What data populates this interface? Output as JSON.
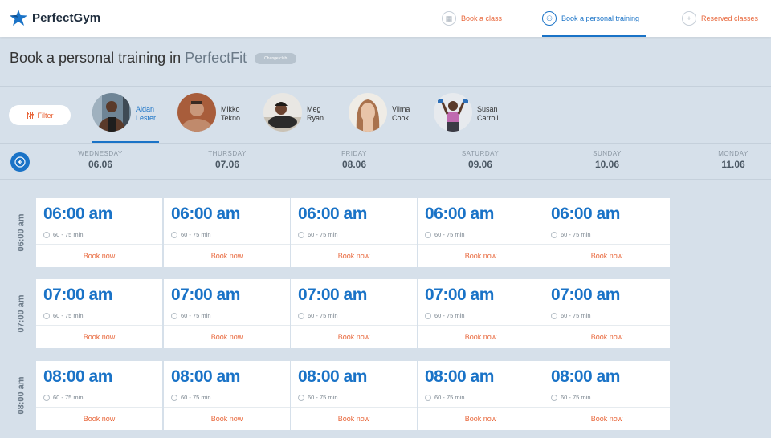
{
  "header": {
    "logo_text": "PerfectGym",
    "nav": [
      {
        "label": "Book a class",
        "icon": "calendar-icon",
        "active": false
      },
      {
        "label": "Book a personal training",
        "icon": "people-icon",
        "active": true
      },
      {
        "label": "Reserved classes",
        "icon": "plus-icon",
        "active": false
      }
    ]
  },
  "page": {
    "title_prefix": "Book a personal training in ",
    "club_name": "PerfectFit",
    "change_club_label": "Change club"
  },
  "filter_label": "Filter",
  "trainers": [
    {
      "first": "Aidan",
      "last": "Lester",
      "active": true
    },
    {
      "first": "Mikko",
      "last": "Tekno",
      "active": false
    },
    {
      "first": "Meg",
      "last": "Ryan",
      "active": false
    },
    {
      "first": "Vilma",
      "last": "Cook",
      "active": false
    },
    {
      "first": "Susan",
      "last": "Carroll",
      "active": false
    }
  ],
  "days": [
    {
      "name": "WEDNESDAY",
      "date": "06.06"
    },
    {
      "name": "THURSDAY",
      "date": "07.06"
    },
    {
      "name": "FRIDAY",
      "date": "08.06"
    },
    {
      "name": "SATURDAY",
      "date": "09.06"
    },
    {
      "name": "SUNDAY",
      "date": "10.06"
    },
    {
      "name": "MONDAY",
      "date": "11.06"
    }
  ],
  "slots": [
    {
      "label": "06:00 am",
      "time": "06:00 am",
      "duration": "60 - 75 min",
      "book": "Book now"
    },
    {
      "label": "07:00 am",
      "time": "07:00 am",
      "duration": "60 - 75 min",
      "book": "Book now"
    },
    {
      "label": "08:00 am",
      "time": "08:00 am",
      "duration": "60 - 75 min",
      "book": "Book now"
    }
  ],
  "colors": {
    "accent": "#1a73c7",
    "book": "#e8663a",
    "background": "#d6e0ea"
  }
}
